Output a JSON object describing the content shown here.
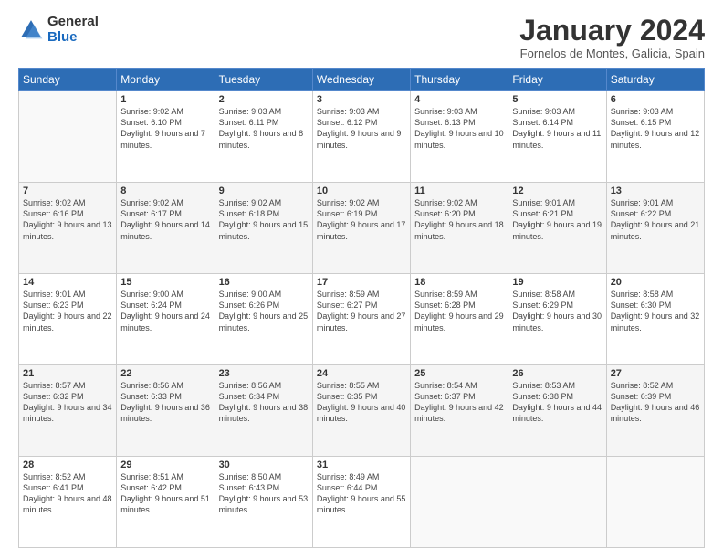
{
  "header": {
    "logo": {
      "general": "General",
      "blue": "Blue"
    },
    "title": "January 2024",
    "location": "Fornelos de Montes, Galicia, Spain"
  },
  "days_of_week": [
    "Sunday",
    "Monday",
    "Tuesday",
    "Wednesday",
    "Thursday",
    "Friday",
    "Saturday"
  ],
  "weeks": [
    [
      {
        "day": "",
        "sunrise": "",
        "sunset": "",
        "daylight": ""
      },
      {
        "day": "1",
        "sunrise": "Sunrise: 9:02 AM",
        "sunset": "Sunset: 6:10 PM",
        "daylight": "Daylight: 9 hours and 7 minutes."
      },
      {
        "day": "2",
        "sunrise": "Sunrise: 9:03 AM",
        "sunset": "Sunset: 6:11 PM",
        "daylight": "Daylight: 9 hours and 8 minutes."
      },
      {
        "day": "3",
        "sunrise": "Sunrise: 9:03 AM",
        "sunset": "Sunset: 6:12 PM",
        "daylight": "Daylight: 9 hours and 9 minutes."
      },
      {
        "day": "4",
        "sunrise": "Sunrise: 9:03 AM",
        "sunset": "Sunset: 6:13 PM",
        "daylight": "Daylight: 9 hours and 10 minutes."
      },
      {
        "day": "5",
        "sunrise": "Sunrise: 9:03 AM",
        "sunset": "Sunset: 6:14 PM",
        "daylight": "Daylight: 9 hours and 11 minutes."
      },
      {
        "day": "6",
        "sunrise": "Sunrise: 9:03 AM",
        "sunset": "Sunset: 6:15 PM",
        "daylight": "Daylight: 9 hours and 12 minutes."
      }
    ],
    [
      {
        "day": "7",
        "sunrise": "Sunrise: 9:02 AM",
        "sunset": "Sunset: 6:16 PM",
        "daylight": "Daylight: 9 hours and 13 minutes."
      },
      {
        "day": "8",
        "sunrise": "Sunrise: 9:02 AM",
        "sunset": "Sunset: 6:17 PM",
        "daylight": "Daylight: 9 hours and 14 minutes."
      },
      {
        "day": "9",
        "sunrise": "Sunrise: 9:02 AM",
        "sunset": "Sunset: 6:18 PM",
        "daylight": "Daylight: 9 hours and 15 minutes."
      },
      {
        "day": "10",
        "sunrise": "Sunrise: 9:02 AM",
        "sunset": "Sunset: 6:19 PM",
        "daylight": "Daylight: 9 hours and 17 minutes."
      },
      {
        "day": "11",
        "sunrise": "Sunrise: 9:02 AM",
        "sunset": "Sunset: 6:20 PM",
        "daylight": "Daylight: 9 hours and 18 minutes."
      },
      {
        "day": "12",
        "sunrise": "Sunrise: 9:01 AM",
        "sunset": "Sunset: 6:21 PM",
        "daylight": "Daylight: 9 hours and 19 minutes."
      },
      {
        "day": "13",
        "sunrise": "Sunrise: 9:01 AM",
        "sunset": "Sunset: 6:22 PM",
        "daylight": "Daylight: 9 hours and 21 minutes."
      }
    ],
    [
      {
        "day": "14",
        "sunrise": "Sunrise: 9:01 AM",
        "sunset": "Sunset: 6:23 PM",
        "daylight": "Daylight: 9 hours and 22 minutes."
      },
      {
        "day": "15",
        "sunrise": "Sunrise: 9:00 AM",
        "sunset": "Sunset: 6:24 PM",
        "daylight": "Daylight: 9 hours and 24 minutes."
      },
      {
        "day": "16",
        "sunrise": "Sunrise: 9:00 AM",
        "sunset": "Sunset: 6:26 PM",
        "daylight": "Daylight: 9 hours and 25 minutes."
      },
      {
        "day": "17",
        "sunrise": "Sunrise: 8:59 AM",
        "sunset": "Sunset: 6:27 PM",
        "daylight": "Daylight: 9 hours and 27 minutes."
      },
      {
        "day": "18",
        "sunrise": "Sunrise: 8:59 AM",
        "sunset": "Sunset: 6:28 PM",
        "daylight": "Daylight: 9 hours and 29 minutes."
      },
      {
        "day": "19",
        "sunrise": "Sunrise: 8:58 AM",
        "sunset": "Sunset: 6:29 PM",
        "daylight": "Daylight: 9 hours and 30 minutes."
      },
      {
        "day": "20",
        "sunrise": "Sunrise: 8:58 AM",
        "sunset": "Sunset: 6:30 PM",
        "daylight": "Daylight: 9 hours and 32 minutes."
      }
    ],
    [
      {
        "day": "21",
        "sunrise": "Sunrise: 8:57 AM",
        "sunset": "Sunset: 6:32 PM",
        "daylight": "Daylight: 9 hours and 34 minutes."
      },
      {
        "day": "22",
        "sunrise": "Sunrise: 8:56 AM",
        "sunset": "Sunset: 6:33 PM",
        "daylight": "Daylight: 9 hours and 36 minutes."
      },
      {
        "day": "23",
        "sunrise": "Sunrise: 8:56 AM",
        "sunset": "Sunset: 6:34 PM",
        "daylight": "Daylight: 9 hours and 38 minutes."
      },
      {
        "day": "24",
        "sunrise": "Sunrise: 8:55 AM",
        "sunset": "Sunset: 6:35 PM",
        "daylight": "Daylight: 9 hours and 40 minutes."
      },
      {
        "day": "25",
        "sunrise": "Sunrise: 8:54 AM",
        "sunset": "Sunset: 6:37 PM",
        "daylight": "Daylight: 9 hours and 42 minutes."
      },
      {
        "day": "26",
        "sunrise": "Sunrise: 8:53 AM",
        "sunset": "Sunset: 6:38 PM",
        "daylight": "Daylight: 9 hours and 44 minutes."
      },
      {
        "day": "27",
        "sunrise": "Sunrise: 8:52 AM",
        "sunset": "Sunset: 6:39 PM",
        "daylight": "Daylight: 9 hours and 46 minutes."
      }
    ],
    [
      {
        "day": "28",
        "sunrise": "Sunrise: 8:52 AM",
        "sunset": "Sunset: 6:41 PM",
        "daylight": "Daylight: 9 hours and 48 minutes."
      },
      {
        "day": "29",
        "sunrise": "Sunrise: 8:51 AM",
        "sunset": "Sunset: 6:42 PM",
        "daylight": "Daylight: 9 hours and 51 minutes."
      },
      {
        "day": "30",
        "sunrise": "Sunrise: 8:50 AM",
        "sunset": "Sunset: 6:43 PM",
        "daylight": "Daylight: 9 hours and 53 minutes."
      },
      {
        "day": "31",
        "sunrise": "Sunrise: 8:49 AM",
        "sunset": "Sunset: 6:44 PM",
        "daylight": "Daylight: 9 hours and 55 minutes."
      },
      {
        "day": "",
        "sunrise": "",
        "sunset": "",
        "daylight": ""
      },
      {
        "day": "",
        "sunrise": "",
        "sunset": "",
        "daylight": ""
      },
      {
        "day": "",
        "sunrise": "",
        "sunset": "",
        "daylight": ""
      }
    ]
  ]
}
